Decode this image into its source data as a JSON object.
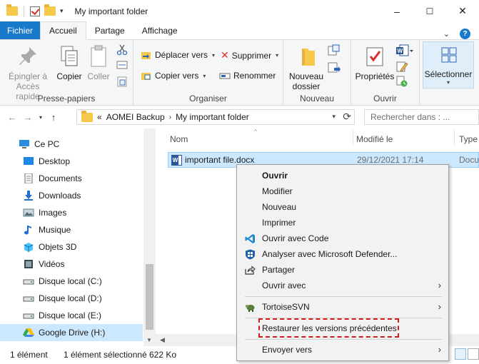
{
  "window": {
    "title": "My important folder",
    "minimize": "–",
    "maximize": "☐",
    "close": "✕"
  },
  "ribbon_tabs": [
    {
      "label": "Fichier"
    },
    {
      "label": "Accueil"
    },
    {
      "label": "Partage"
    },
    {
      "label": "Affichage"
    }
  ],
  "ribbon_right": {
    "collapse": "⌄",
    "help": "?"
  },
  "ribbon": {
    "presse_papiers": {
      "label": "Presse-papiers",
      "pin": "Épingler à\nAccès rapide",
      "copy": "Copier",
      "paste": "Coller"
    },
    "organiser": {
      "label": "Organiser",
      "move_to": "Déplacer vers",
      "copy_to": "Copier vers",
      "delete": "Supprimer",
      "rename": "Renommer"
    },
    "nouveau": {
      "label": "Nouveau",
      "new_folder": "Nouveau\ndossier"
    },
    "ouvrir": {
      "label": "Ouvrir",
      "properties": "Propriétés"
    },
    "selectionner": {
      "label": "Sélectionner"
    }
  },
  "navbar": {
    "breadcrumb_prefix": "«",
    "crumbs": [
      "AOMEI Backup",
      "My important folder"
    ],
    "search_placeholder": "Rechercher dans : ..."
  },
  "nav_tree": [
    {
      "label": "Ce PC",
      "icon": "pc-icon"
    },
    {
      "label": "Desktop",
      "icon": "desktop-icon"
    },
    {
      "label": "Documents",
      "icon": "documents-icon"
    },
    {
      "label": "Downloads",
      "icon": "downloads-icon"
    },
    {
      "label": "Images",
      "icon": "images-icon"
    },
    {
      "label": "Musique",
      "icon": "music-icon"
    },
    {
      "label": "Objets 3D",
      "icon": "objects3d-icon"
    },
    {
      "label": "Vidéos",
      "icon": "videos-icon"
    },
    {
      "label": "Disque local (C:)",
      "icon": "drive-icon"
    },
    {
      "label": "Disque local (D:)",
      "icon": "drive-icon"
    },
    {
      "label": "Disque local (E:)",
      "icon": "drive-icon"
    },
    {
      "label": "Google Drive (H:)",
      "icon": "google-drive-icon"
    }
  ],
  "file_list": {
    "columns": [
      "Nom",
      "Modifié le",
      "Type"
    ],
    "rows": [
      {
        "name": "important file.docx",
        "modified": "29/12/2021 17:14",
        "type": "Docu"
      }
    ]
  },
  "context_menu": {
    "items": [
      {
        "label": "Ouvrir"
      },
      {
        "label": "Modifier"
      },
      {
        "label": "Nouveau"
      },
      {
        "label": "Imprimer"
      },
      {
        "label": "Ouvrir avec Code"
      },
      {
        "label": "Analyser avec Microsoft Defender..."
      },
      {
        "label": "Partager"
      },
      {
        "label": "Ouvrir avec"
      },
      {
        "label": "TortoiseSVN"
      },
      {
        "label": "Restaurer les versions précédentes"
      },
      {
        "label": "Envoyer vers"
      }
    ],
    "submenu_arrow": "›"
  },
  "statusbar": {
    "count": "1 élément",
    "selected": "1 élément sélectionné",
    "size": "622 Ko"
  },
  "colors": {
    "accent": "#1979ca",
    "selection": "#cce8ff",
    "highlight_border": "#d21b1b"
  }
}
